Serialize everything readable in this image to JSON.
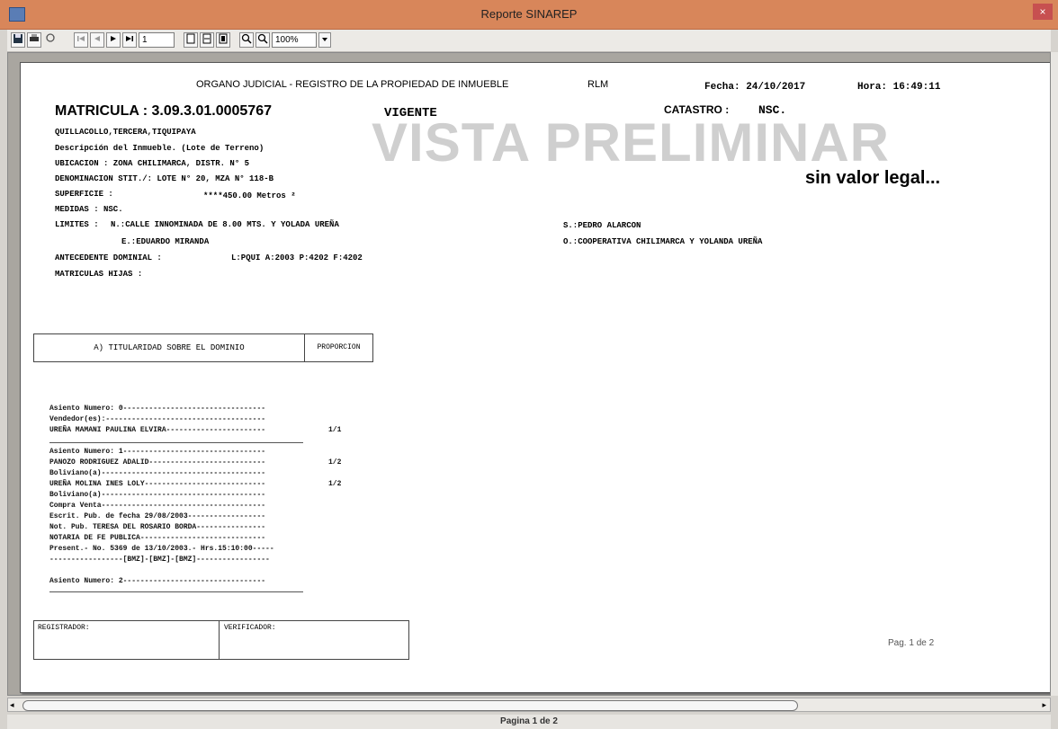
{
  "window": {
    "title": "Reporte SINAREP",
    "close_glyph": "×"
  },
  "toolbar": {
    "page_number": "1",
    "zoom": "100%"
  },
  "report": {
    "header_org": "ORGANO JUDICIAL - REGISTRO DE LA PROPIEDAD DE INMUEBLE",
    "header_code": "RLM",
    "fecha": "Fecha: 24/10/2017",
    "hora": "Hora: 16:49:11",
    "matricula": "MATRICULA : 3.09.3.01.0005767",
    "estado": "VIGENTE",
    "catastro_label": "CATASTRO :",
    "catastro_value": "NSC.",
    "watermark": "VISTA PRELIMINAR",
    "watermark_sub": "sin valor legal...",
    "location": "QUILLACOLLO,TERCERA,TIQUIPAYA",
    "descripcion": "Descripción del Inmueble.  (Lote de Terreno)",
    "ubicacion": "UBICACION : ZONA CHILIMARCA, DISTR. N° 5",
    "denominacion": "DENOMINACION STIT./: LOTE N° 20, MZA N° 118-B",
    "superficie_label": "SUPERFICIE :",
    "superficie_value": "****450.00 Metros ²",
    "medidas": "MEDIDAS : NSC.",
    "limites_label": "LIMITES :",
    "limite_n": "N.:CALLE INNOMINADA DE 8.00 MTS. Y YOLADA UREÑA",
    "limite_e": "E.:EDUARDO MIRANDA",
    "limite_s": "S.:PEDRO ALARCON",
    "limite_o": "O.:COOPERATIVA CHILIMARCA Y YOLANDA UREÑA",
    "antecedente": "ANTECEDENTE DOMINIAL :",
    "antecedente_value": "L:PQUI A:2003 P:4202 F:4202",
    "matriculas_hijas": "MATRICULAS HIJAS :",
    "titularidad_header": "A) TITULARIDAD SOBRE EL DOMINIO",
    "proporcion_header": "PROPORCION",
    "records": [
      {
        "text": "Asiento Numero: 0---------------------------------",
        "prop": ""
      },
      {
        "text": "Vendedor(es):-------------------------------------",
        "prop": ""
      },
      {
        "text": "UREÑA MAMANI PAULINA ELVIRA-----------------------",
        "prop": "1/1"
      },
      {
        "text": "Asiento Numero: 1---------------------------------",
        "prop": ""
      },
      {
        "text": "PANOZO RODRIGUEZ ADALID---------------------------",
        "prop": "1/2"
      },
      {
        "text": "Boliviano(a)--------------------------------------",
        "prop": ""
      },
      {
        "text": "UREÑA MOLINA INES LOLY----------------------------",
        "prop": "1/2"
      },
      {
        "text": "Boliviano(a)--------------------------------------",
        "prop": ""
      },
      {
        "text": "Compra Venta--------------------------------------",
        "prop": ""
      },
      {
        "text": "Escrit. Pub. de fecha 29/08/2003------------------",
        "prop": ""
      },
      {
        "text": "Not. Pub. TERESA DEL ROSARIO BORDA----------------",
        "prop": ""
      },
      {
        "text": "NOTARIA DE FE PUBLICA-----------------------------",
        "prop": ""
      },
      {
        "text": "Present.- No. 5369 de 13/10/2003.- Hrs.15:10:00-----",
        "prop": ""
      },
      {
        "text": "-----------------[BMZ]-[BMZ]-[BMZ]-----------------",
        "prop": ""
      },
      {
        "text": "Asiento Numero: 2---------------------------------",
        "prop": ""
      }
    ],
    "registrador": "REGISTRADOR:",
    "verificador": "VERIFICADOR:",
    "page_label": "Pag. 1 de 2"
  },
  "status": {
    "text": "Pagina 1 de 2"
  }
}
